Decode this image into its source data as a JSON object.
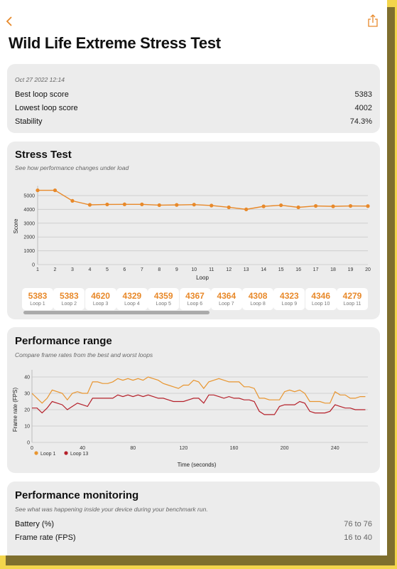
{
  "header": {
    "back_icon": "chevron-left-icon",
    "share_icon": "share-icon",
    "title": "Wild Life Extreme Stress Test",
    "accent": "#e8892a"
  },
  "summary": {
    "date": "Oct 27 2022 12:14",
    "rows": [
      {
        "label": "Best loop score",
        "value": "5383"
      },
      {
        "label": "Lowest loop score",
        "value": "4002"
      },
      {
        "label": "Stability",
        "value": "74.3%"
      }
    ]
  },
  "stress": {
    "title": "Stress Test",
    "subtitle": "See how performance changes under load",
    "loops": [
      {
        "score": "5383",
        "label": "Loop 1"
      },
      {
        "score": "5383",
        "label": "Loop 2"
      },
      {
        "score": "4620",
        "label": "Loop 3"
      },
      {
        "score": "4329",
        "label": "Loop 4"
      },
      {
        "score": "4359",
        "label": "Loop 5"
      },
      {
        "score": "4367",
        "label": "Loop 6"
      },
      {
        "score": "4364",
        "label": "Loop 7"
      },
      {
        "score": "4308",
        "label": "Loop 8"
      },
      {
        "score": "4323",
        "label": "Loop 9"
      },
      {
        "score": "4346",
        "label": "Loop 10"
      },
      {
        "score": "4279",
        "label": "Loop 11"
      }
    ]
  },
  "range": {
    "title": "Performance range",
    "subtitle": "Compare frame rates from the best and worst loops"
  },
  "monitoring": {
    "title": "Performance monitoring",
    "subtitle": "See what was happening inside your device during your benchmark run.",
    "rows": [
      {
        "label": "Battery (%)",
        "value": "76 to 76"
      },
      {
        "label": "Frame rate (FPS)",
        "value": "16 to 40"
      }
    ]
  },
  "chart_data": [
    {
      "type": "line",
      "xlabel": "Loop",
      "ylabel": "Score",
      "x": [
        1,
        2,
        3,
        4,
        5,
        6,
        7,
        8,
        9,
        10,
        11,
        12,
        13,
        14,
        15,
        16,
        17,
        18,
        19,
        20
      ],
      "yticks": [
        0,
        1000,
        2000,
        3000,
        4000,
        5000
      ],
      "ylim": [
        0,
        5700
      ],
      "grid": true,
      "color": "#e8892a",
      "values": [
        5383,
        5383,
        4620,
        4329,
        4359,
        4367,
        4364,
        4308,
        4323,
        4346,
        4279,
        4150,
        4002,
        4220,
        4300,
        4150,
        4250,
        4220,
        4250,
        4240
      ]
    },
    {
      "type": "line",
      "xlabel": "Time (seconds)",
      "ylabel": "Frame rate (FPS)",
      "xticks": [
        0,
        40,
        80,
        120,
        160,
        200,
        240
      ],
      "yticks": [
        0,
        10,
        20,
        30,
        40
      ],
      "xlim": [
        0,
        266
      ],
      "ylim": [
        0,
        44
      ],
      "grid": true,
      "legend": "bottom-left",
      "x_step": 4,
      "series": [
        {
          "name": "Loop 1",
          "color": "#e8952f",
          "values": [
            30,
            27,
            24,
            27,
            32,
            31,
            30,
            26,
            30,
            31,
            30,
            30,
            37,
            37,
            36,
            36,
            37,
            39,
            38,
            39,
            38,
            39,
            38,
            40,
            39,
            38,
            36,
            35,
            34,
            33,
            35,
            35,
            38,
            37,
            33,
            37,
            38,
            39,
            38,
            37,
            37,
            37,
            34,
            34,
            33,
            27,
            27,
            26,
            26,
            26,
            31,
            32,
            31,
            32,
            30,
            25,
            25,
            25,
            24,
            24,
            31,
            29,
            29,
            27,
            27,
            28,
            28
          ]
        },
        {
          "name": "Loop 13",
          "color": "#b5202a",
          "values": [
            21,
            21,
            18,
            21,
            25,
            24,
            23,
            20,
            22,
            24,
            23,
            22,
            27,
            27,
            27,
            27,
            27,
            29,
            28,
            29,
            28,
            29,
            28,
            29,
            28,
            27,
            27,
            26,
            25,
            25,
            25,
            26,
            27,
            27,
            24,
            29,
            29,
            28,
            27,
            28,
            27,
            27,
            26,
            26,
            25,
            19,
            17,
            17,
            17,
            22,
            23,
            23,
            23,
            25,
            24,
            19,
            18,
            18,
            18,
            19,
            23,
            22,
            21,
            21,
            20,
            20,
            20
          ]
        }
      ]
    }
  ]
}
